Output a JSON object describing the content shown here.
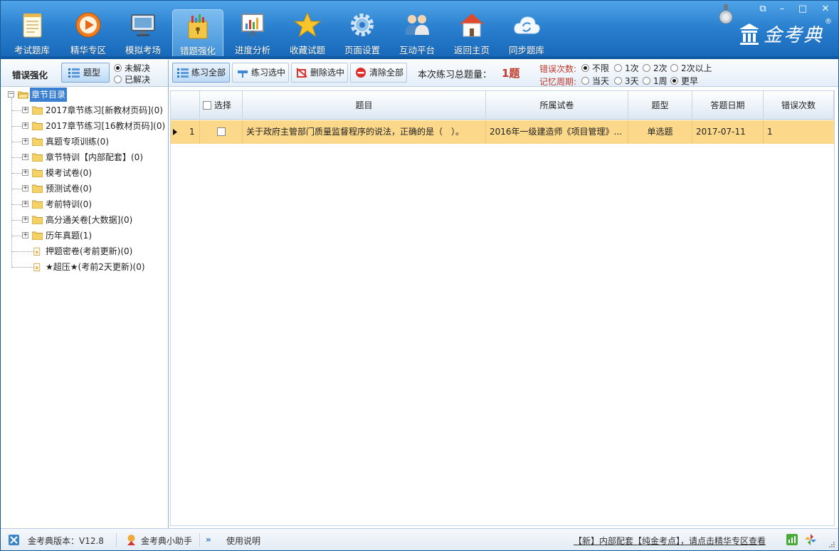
{
  "window": {
    "controls": {
      "restore": "⧉",
      "minimize": "–",
      "maximize": "□",
      "close": "✕"
    }
  },
  "nav": [
    {
      "label": "考试题库",
      "icon": "notepad-icon"
    },
    {
      "label": "精华专区",
      "icon": "play-disc-icon"
    },
    {
      "label": "模拟考场",
      "icon": "monitor-icon"
    },
    {
      "label": "错题强化",
      "icon": "lock-chart-icon",
      "active": true
    },
    {
      "label": "进度分析",
      "icon": "presentation-chart-icon"
    },
    {
      "label": "收藏试题",
      "icon": "star-icon"
    },
    {
      "label": "页面设置",
      "icon": "gear-icon"
    },
    {
      "label": "互动平台",
      "icon": "users-icon"
    },
    {
      "label": "返回主页",
      "icon": "home-icon"
    },
    {
      "label": "同步题库",
      "icon": "cloud-sync-icon"
    }
  ],
  "brand": {
    "logo_text": "金考典",
    "registered": "®"
  },
  "left": {
    "title": "错误强化",
    "type_button": "题型",
    "status_options": [
      {
        "label": "未解决",
        "checked": true
      },
      {
        "label": "已解决",
        "checked": false
      }
    ]
  },
  "tree": {
    "root": "章节目录",
    "items": [
      {
        "label": "2017章节练习[新教材页码](0)",
        "kind": "folder"
      },
      {
        "label": "2017章节练习[16教材页码](0)",
        "kind": "folder"
      },
      {
        "label": "真题专项训练(0)",
        "kind": "folder"
      },
      {
        "label": "章节特训【内部配套】(0)",
        "kind": "folder"
      },
      {
        "label": "模考试卷(0)",
        "kind": "folder"
      },
      {
        "label": "预测试卷(0)",
        "kind": "folder"
      },
      {
        "label": "考前特训(0)",
        "kind": "folder"
      },
      {
        "label": "高分通关卷[大数据](0)",
        "kind": "folder"
      },
      {
        "label": "历年真题(1)",
        "kind": "folder"
      },
      {
        "label": "押题密卷(考前更新)(0)",
        "kind": "file"
      },
      {
        "label": "★超压★(考前2天更新)(0)",
        "kind": "file"
      }
    ]
  },
  "toolbar": {
    "practice_all": "练习全部",
    "practice_selected": "练习选中",
    "delete_selected": "删除选中",
    "clear_all": "清除全部",
    "total_label": "本次练习总题量：",
    "total_value": "1题"
  },
  "filters": {
    "error_count": {
      "label": "错误次数:",
      "options": [
        {
          "label": "不限",
          "checked": true
        },
        {
          "label": "1次",
          "checked": false
        },
        {
          "label": "2次",
          "checked": false
        },
        {
          "label": "2次以上",
          "checked": false
        }
      ]
    },
    "memory_period": {
      "label": "记忆周期:",
      "options": [
        {
          "label": "当天",
          "checked": false
        },
        {
          "label": "3天",
          "checked": false
        },
        {
          "label": "1周",
          "checked": false
        },
        {
          "label": "更早",
          "checked": true
        }
      ]
    }
  },
  "table": {
    "columns": {
      "select": "选择",
      "question": "题目",
      "paper": "所属试卷",
      "type": "题型",
      "date": "答题日期",
      "errors": "错误次数"
    },
    "rows": [
      {
        "index": "1",
        "question": "关于政府主管部门质量监督程序的说法，正确的是（　）。",
        "paper": "2016年一级建造师《项目管理》...",
        "type": "单选题",
        "date": "2017-07-11",
        "errors": "1"
      }
    ]
  },
  "status": {
    "version": "金考典版本：V12.8",
    "assistant": "金考典小助手",
    "help": "使用说明",
    "notice": "【新】内部配套【纯金考点】，请点击精华专区查看"
  }
}
